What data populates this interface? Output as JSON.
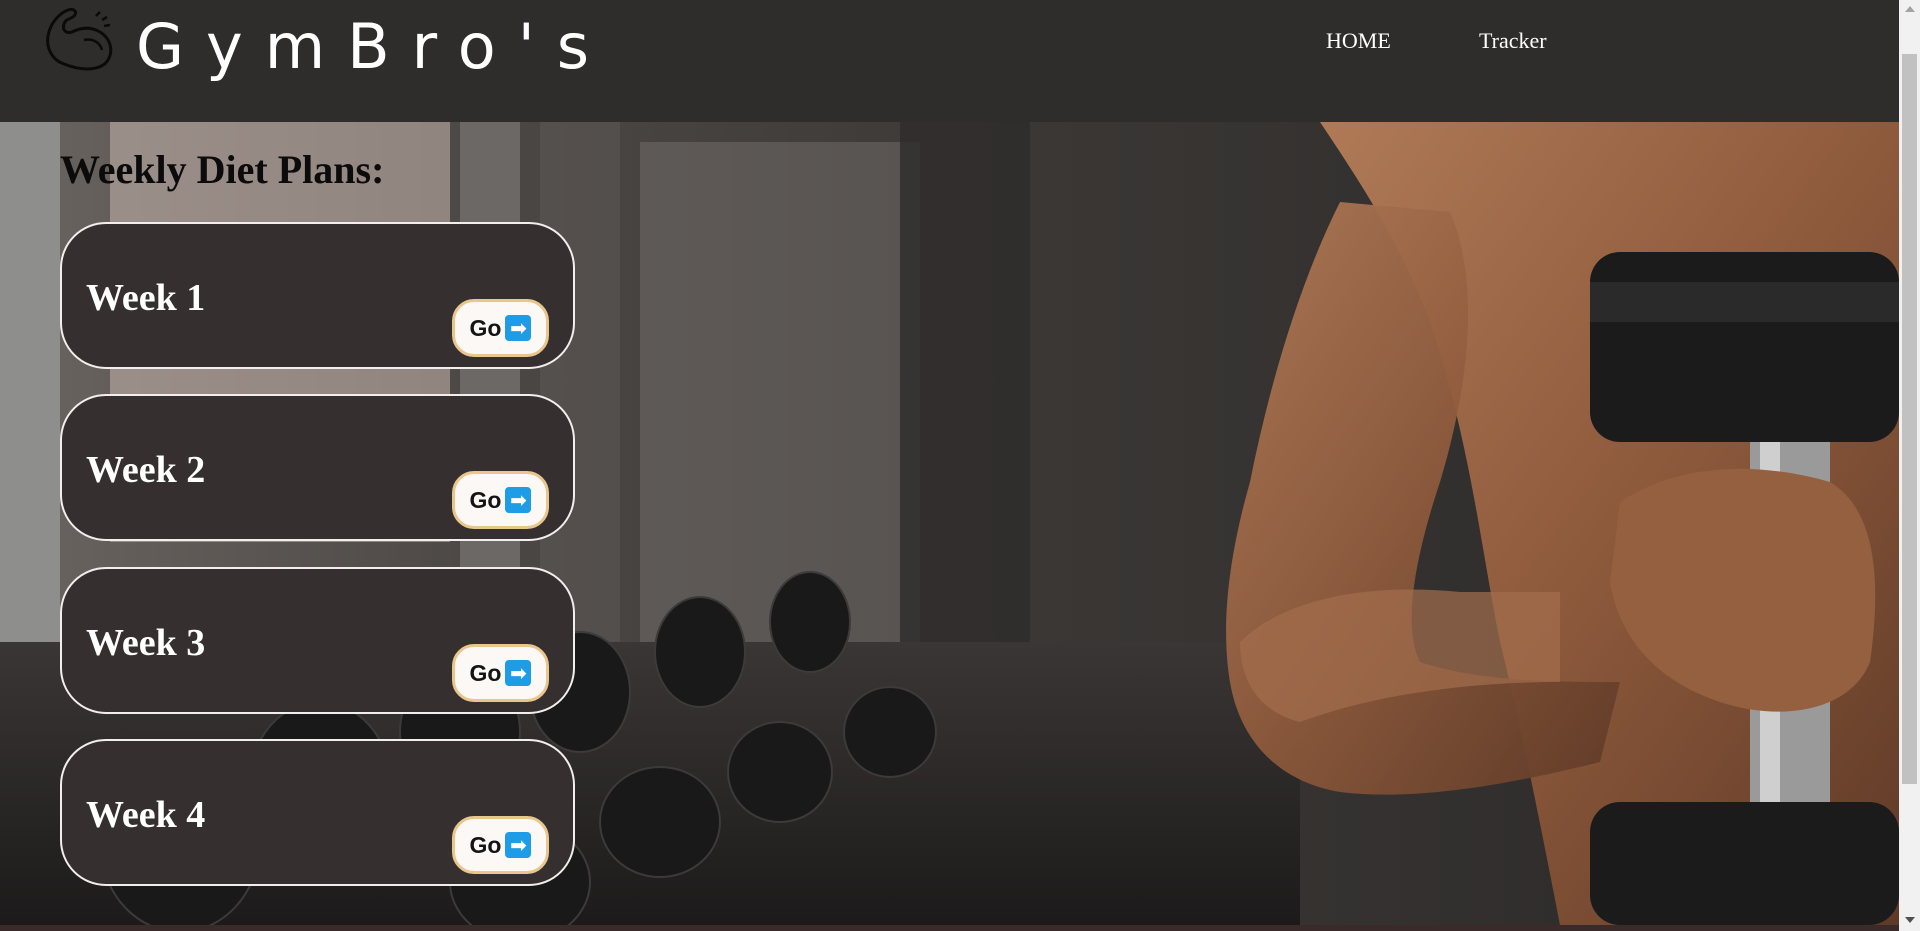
{
  "header": {
    "brand": "GymBro's",
    "nav": [
      {
        "label": "HOME"
      },
      {
        "label": "Tracker"
      }
    ],
    "logo_icon": "flexed-bicep-icon"
  },
  "main": {
    "section_title": "Weekly Diet Plans:",
    "weeks": [
      {
        "title": "Week 1",
        "button_label": "Go",
        "button_icon": "right-arrow-icon"
      },
      {
        "title": "Week 2",
        "button_label": "Go",
        "button_icon": "right-arrow-icon"
      },
      {
        "title": "Week 3",
        "button_label": "Go",
        "button_icon": "right-arrow-icon"
      },
      {
        "title": "Week 4",
        "button_label": "Go",
        "button_icon": "right-arrow-icon"
      }
    ]
  },
  "colors": {
    "header_bg": "#2f2c2c",
    "card_bg": "#352f2f",
    "card_border": "#f3eeee",
    "button_bg": "#fbf8f5",
    "button_border": "#e9c68c",
    "arrow_bg": "#1e9ce6"
  }
}
